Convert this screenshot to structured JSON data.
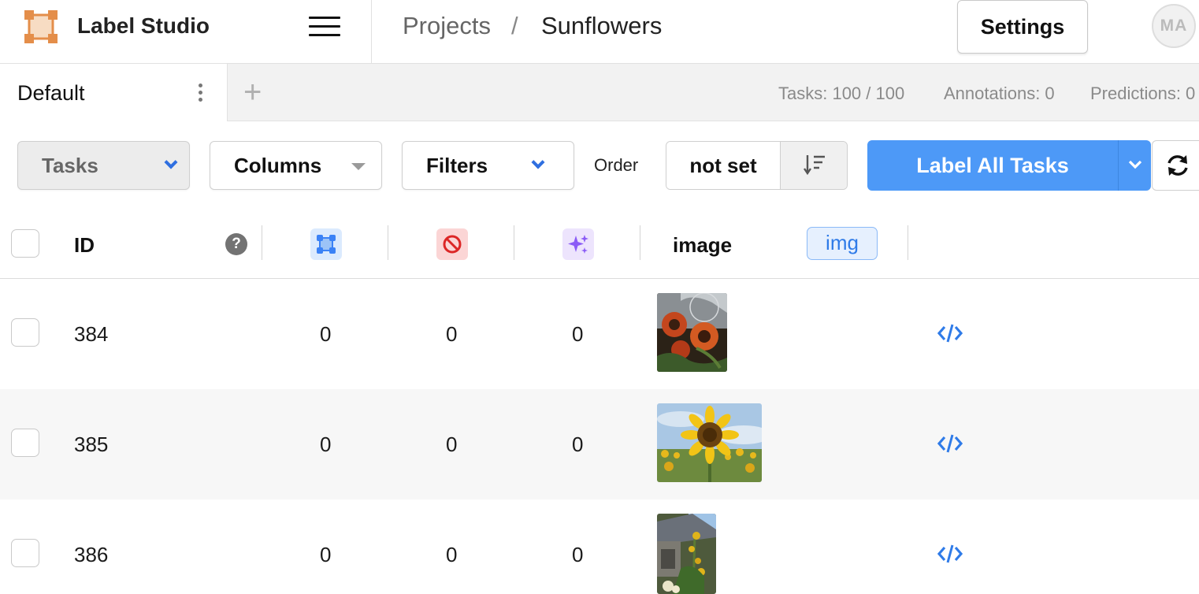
{
  "app": {
    "name": "Label Studio",
    "accent": "#4d99f7",
    "logo_color": "#e48e4a"
  },
  "header": {
    "breadcrumb": {
      "projects": "Projects",
      "separator": "/",
      "current": "Sunflowers"
    },
    "settings_label": "Settings",
    "avatar_initials": "MA",
    "menu_icon": "hamburger-icon"
  },
  "tabs": {
    "items": [
      {
        "label": "Default"
      }
    ],
    "add_icon": "plus-icon",
    "stats": {
      "tasks": "Tasks: 100 / 100",
      "annotations": "Annotations: 0",
      "predictions": "Predictions: 0"
    }
  },
  "toolbar": {
    "tasks_label": "Tasks",
    "columns_label": "Columns",
    "filters_label": "Filters",
    "order_label": "Order",
    "order_value": "not set",
    "label_all_label": "Label All Tasks",
    "refresh_icon": "refresh-icon"
  },
  "table": {
    "columns": {
      "id": "ID",
      "annotations_icon": "annotations-icon",
      "cancelled_icon": "cancelled-icon",
      "predictions_icon": "predictions-icon",
      "image": "image",
      "image_type": "img"
    },
    "rows": [
      {
        "id": "384",
        "annotations": "0",
        "cancelled": "0",
        "predictions": "0",
        "image": "sunflower-thumbnail-red"
      },
      {
        "id": "385",
        "annotations": "0",
        "cancelled": "0",
        "predictions": "0",
        "image": "sunflower-thumbnail-field"
      },
      {
        "id": "386",
        "annotations": "0",
        "cancelled": "0",
        "predictions": "0",
        "image": "sunflower-thumbnail-garden"
      }
    ]
  }
}
